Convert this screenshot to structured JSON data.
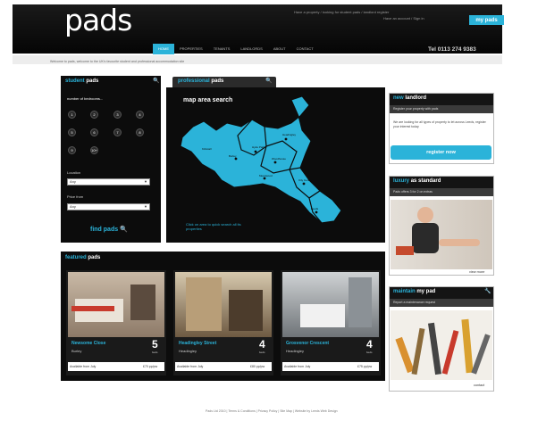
{
  "header": {
    "logo": "pads",
    "top_link_1": "Have a property / looking for student pads / landlord register",
    "top_link_2": "Have an account / Sign in",
    "my_pads": "my pads",
    "phone": "Tel 0113 274 9383",
    "nav": [
      "home",
      "properties",
      "tenants",
      "landlords",
      "about",
      "contact"
    ]
  },
  "breadcrumb": "Welcome to pads, welcome to the UK's favourite student and professional accommodation site",
  "student": {
    "title_color": "student",
    "title_white": "pads",
    "bedrooms_label": "number of bedrooms...",
    "bedrooms": [
      "1",
      "2",
      "3",
      "4",
      "5",
      "6",
      "7",
      "8",
      "9",
      "10+"
    ],
    "location_label": "Location",
    "location_value": "Any",
    "price_label": "Price from",
    "price_value": "Any",
    "find_label": "find pads"
  },
  "professional": {
    "title_color": "professional",
    "title_white": "pads"
  },
  "map": {
    "title": "map area search",
    "hint": "Click on area to quick search all its properties",
    "areas": [
      "Headingley",
      "Hyde Park",
      "Burley",
      "Woodhouse",
      "Kirkstall",
      "Meanwood",
      "City Centre",
      "Leeds"
    ]
  },
  "featured": {
    "title_color": "featured",
    "title_white": "pads",
    "items": [
      {
        "street": "Newsome Close",
        "area": "Burley",
        "beds": "5",
        "beds_label": "beds",
        "available": "Available from July",
        "price": "£70 pp/pw"
      },
      {
        "street": "Headingley Street",
        "area": "Headingley",
        "beds": "4",
        "beds_label": "beds",
        "available": "Available from July",
        "price": "£80 pp/pw"
      },
      {
        "street": "Grosvenor Crescent",
        "area": "Headingley",
        "beds": "4",
        "beds_label": "beds",
        "available": "Available from July",
        "price": "£75 pp/pw"
      }
    ]
  },
  "sidebar": {
    "landlord": {
      "title_color": "new",
      "title_white": "landlord",
      "subtitle": "Register your property with pads",
      "text": "We are looking for all types of property to let across Leeds, register your interest today",
      "button": "register now"
    },
    "luxury": {
      "title_color": "luxury",
      "title_white": "as standard",
      "subtitle": "Pads offers 3 for 2 on extras",
      "see_more": "view more"
    },
    "maintain": {
      "title_color": "maintain",
      "title_white": "my pad",
      "subtitle": "Report a maintenance request",
      "see_more": "contact"
    }
  },
  "footer": "Pads Ltd 2010 | Terms & Conditions | Privacy Policy | Site Map | Website by Leeds Web Design",
  "colors": {
    "accent": "#2bb3d9",
    "dark": "#0c0c0c"
  }
}
